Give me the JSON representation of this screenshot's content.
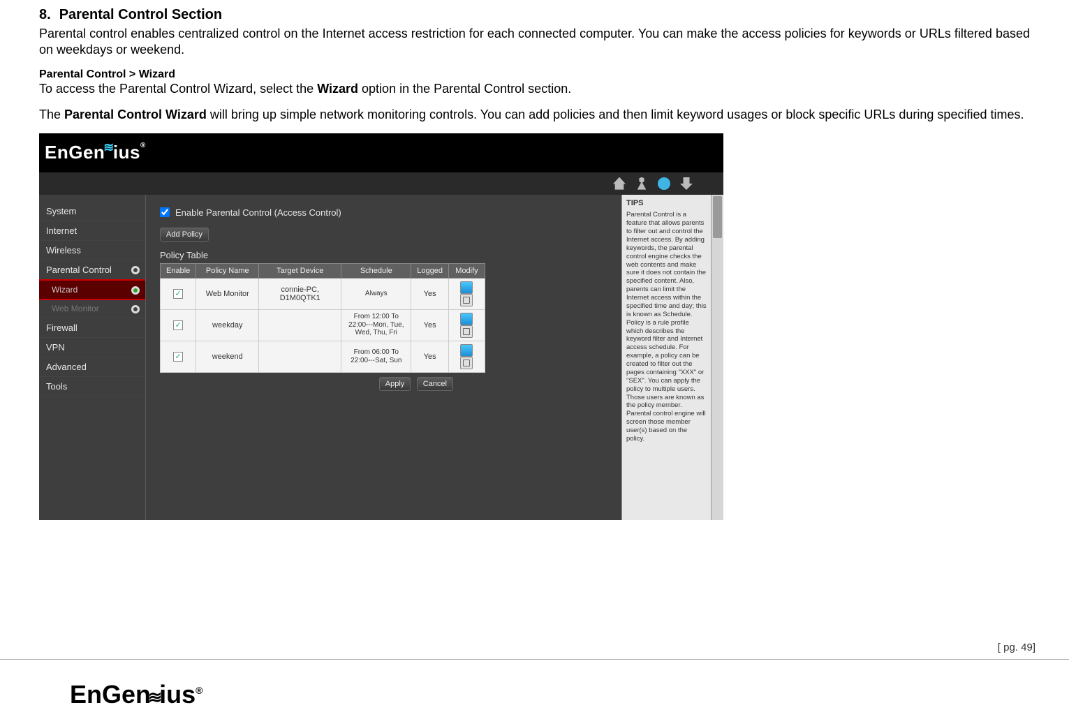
{
  "section": {
    "number": "8.",
    "title": "Parental Control Section"
  },
  "intro": "Parental control enables centralized control on the Internet access restriction for each connected computer. You can make the access policies for keywords or URLs filtered based on weekdays or weekend.",
  "breadcrumb": "Parental Control > Wizard",
  "line2_a": "To access the Parental Control Wizard, select the ",
  "line2_b": "Wizard",
  "line2_c": " option in the Parental Control section.",
  "p3_a": "The ",
  "p3_b": "Parental Control Wizard",
  "p3_c": " will bring up simple network monitoring controls. You can add policies and then limit keyword usages or block specific URLs during specified times.",
  "ss": {
    "logo": "EnGenius",
    "nav": [
      "System",
      "Internet",
      "Wireless",
      "Parental Control",
      "Wizard",
      "Web Monitor",
      "Firewall",
      "VPN",
      "Advanced",
      "Tools"
    ],
    "enable_label": "Enable Parental Control (Access Control)",
    "add_policy": "Add Policy",
    "table_title": "Policy Table",
    "headers": [
      "Enable",
      "Policy Name",
      "Target Device",
      "Schedule",
      "Logged",
      "Modify"
    ],
    "rows": [
      {
        "name": "Web Monitor",
        "device": "connie-PC, D1M0QTK1",
        "schedule": "Always",
        "logged": "Yes"
      },
      {
        "name": "weekday",
        "device": "",
        "schedule": "From 12:00 To 22:00---Mon, Tue, Wed, Thu, Fri",
        "logged": "Yes"
      },
      {
        "name": "weekend",
        "device": "",
        "schedule": "From 06:00 To 22:00---Sat, Sun",
        "logged": "Yes"
      }
    ],
    "apply": "Apply",
    "cancel": "Cancel",
    "tips_h": "TIPS",
    "tips": "Parental Control is a feature that allows parents to filter out and control the Internet access. By adding keywords, the parental control engine checks the web contents and make sure it does not contain the specified content. Also, parents can limit the Internet access within the specified time and day; this is known as Schedule. Policy is a rule profile which describes the keyword filter and Internet access schedule. For example, a policy can be created to filter out the pages containing \"XXX\" or \"SEX\". You can apply the policy to multiple users. Those users are known as the policy member. Parental control engine will screen those member user(s) based on the policy."
  },
  "page_num": "[ pg. 49]",
  "footer_logo": "EnGenius"
}
